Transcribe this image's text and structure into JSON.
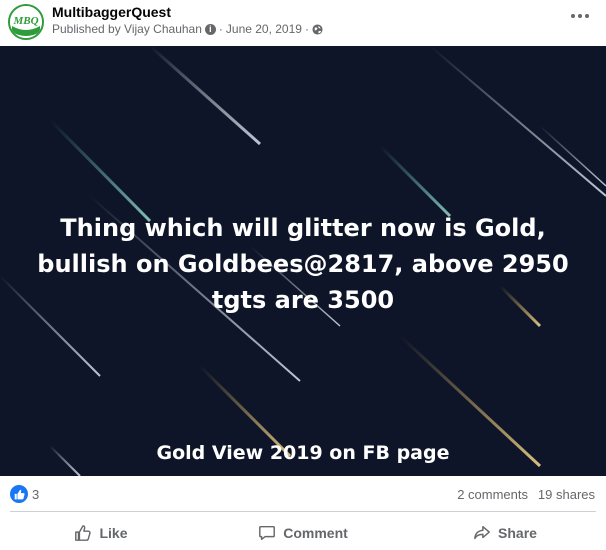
{
  "post": {
    "page_name": "MultibaggerQuest",
    "avatar_text": "MBQ",
    "published_by": "Published by Vijay Chauhan",
    "date": "June 20, 2019",
    "separator": "·",
    "image": {
      "headline": "Thing which will glitter now is Gold, bullish on Goldbees@2817, above 2950 tgts are 3500",
      "caption": "Gold View 2019 on FB page",
      "background_color": "#0e1528"
    }
  },
  "stats": {
    "reactions_count": "3",
    "comments": "2 comments",
    "shares": "19 shares"
  },
  "actions": {
    "like": "Like",
    "comment": "Comment",
    "share": "Share"
  },
  "icons": {
    "more": "more-options-icon",
    "globe": "globe-icon",
    "info": "info-icon",
    "like_badge": "like-reaction-icon",
    "like_action": "thumbs-up-icon",
    "comment_action": "comment-icon",
    "share_action": "share-icon"
  },
  "colors": {
    "facebook_blue": "#1877f2",
    "secondary_text": "#65676b",
    "avatar_green": "#2e9c3a"
  }
}
